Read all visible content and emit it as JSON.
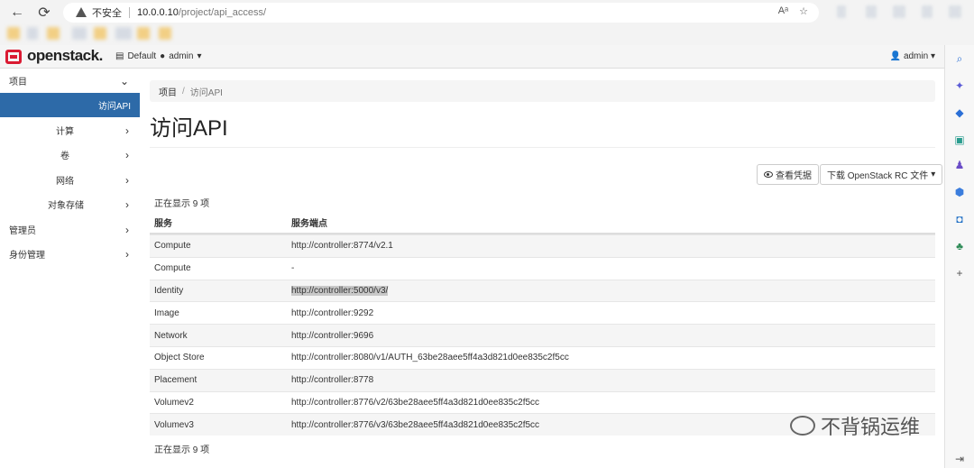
{
  "browser": {
    "back": "←",
    "reload": "⟳",
    "security_label": "不安全",
    "url_host": "10.0.0.10",
    "url_path": "/project/api_access/"
  },
  "header": {
    "logo": "openstack.",
    "domain": "Default",
    "project": "admin",
    "user": "admin"
  },
  "sidebar": {
    "items": [
      {
        "label": "项目"
      },
      {
        "label": "访问API"
      },
      {
        "label": "计算"
      },
      {
        "label": "卷"
      },
      {
        "label": "网络"
      },
      {
        "label": "对象存储"
      },
      {
        "label": "管理员"
      },
      {
        "label": "身份管理"
      }
    ]
  },
  "main": {
    "breadcrumb": [
      "项目",
      "访问API"
    ],
    "title": "访问API",
    "view_credentials_label": "查看凭据",
    "download_rc_label": "下载 OpenStack RC 文件",
    "count_text": "正在显示 9 项",
    "columns": [
      "服务",
      "服务端点"
    ],
    "rows": [
      {
        "service": "Compute",
        "endpoint": "http://controller:8774/v2.1"
      },
      {
        "service": "Compute",
        "endpoint": "-"
      },
      {
        "service": "Identity",
        "endpoint": "http://controller:5000/v3/"
      },
      {
        "service": "Image",
        "endpoint": "http://controller:9292"
      },
      {
        "service": "Network",
        "endpoint": "http://controller:9696"
      },
      {
        "service": "Object Store",
        "endpoint": "http://controller:8080/v1/AUTH_63be28aee5ff4a3d821d0ee835c2f5cc"
      },
      {
        "service": "Placement",
        "endpoint": "http://controller:8778"
      },
      {
        "service": "Volumev2",
        "endpoint": "http://controller:8776/v2/63be28aee5ff4a3d821d0ee835c2f5cc"
      },
      {
        "service": "Volumev3",
        "endpoint": "http://controller:8776/v3/63be28aee5ff4a3d821d0ee835c2f5cc"
      }
    ]
  },
  "watermark": "不背锅运维",
  "colors": {
    "accent": "#2d6aa8",
    "brand": "#da1a32"
  }
}
